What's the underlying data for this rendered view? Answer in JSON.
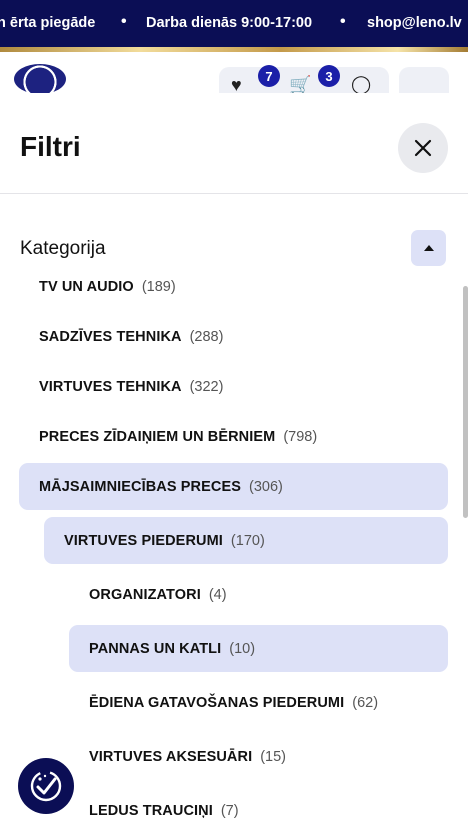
{
  "topbar": {
    "items": [
      "n ērta piegāde",
      "Darba dienās 9:00-17:00",
      "shop@leno.lv"
    ],
    "separator": "•",
    "background": "#0b0e55"
  },
  "header": {
    "wishlist_count": "7",
    "cart_count": "3",
    "icons": [
      "heart-icon",
      "cart-icon",
      "user-icon",
      "menu-icon"
    ]
  },
  "drawer": {
    "title": "Filtri",
    "close_icon": "close-icon",
    "section": {
      "title": "Kategorija",
      "toggle_icon": "caret-up-icon"
    },
    "categories": [
      {
        "name": "TV UN AUDIO",
        "count": "(189)",
        "level": 0,
        "active": false
      },
      {
        "name": "SADZĪVES TEHNIKA",
        "count": "(288)",
        "level": 0,
        "active": false
      },
      {
        "name": "VIRTUVES TEHNIKA",
        "count": "(322)",
        "level": 0,
        "active": false
      },
      {
        "name": "PRECES ZĪDAIŅIEM UN BĒRNIEM",
        "count": "(798)",
        "level": 0,
        "active": false
      },
      {
        "name": "MĀJSAIMNIECĪBAS PRECES",
        "count": "(306)",
        "level": 0,
        "active": true
      },
      {
        "name": "VIRTUVES PIEDERUMI",
        "count": "(170)",
        "level": 1,
        "active": true
      },
      {
        "name": "ORGANIZATORI",
        "count": "(4)",
        "level": 2,
        "active": false
      },
      {
        "name": "PANNAS UN KATLI",
        "count": "(10)",
        "level": 2,
        "active": true
      },
      {
        "name": "ĒDIENA GATAVOŠANAS PIEDERUMI",
        "count": "(62)",
        "level": 2,
        "active": false
      },
      {
        "name": "VIRTUVES AKSESUĀRI",
        "count": "(15)",
        "level": 2,
        "active": false
      },
      {
        "name": "LEDUS TRAUCIŅI",
        "count": "(7)",
        "level": 2,
        "active": false
      }
    ],
    "accent": "#dde1f7"
  },
  "fab": {
    "icon": "badge-check-icon"
  }
}
